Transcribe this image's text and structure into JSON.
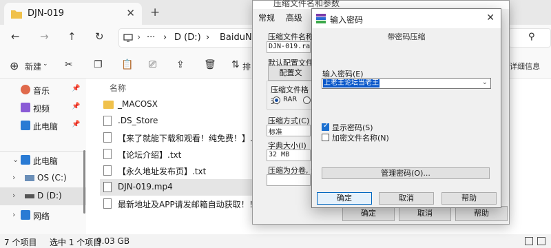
{
  "explorer": {
    "tab_title": "DJN-019",
    "breadcrumb": [
      "D (D:)",
      "BaiduNet"
    ],
    "toolbar": {
      "new_label": "新建",
      "sort_label": "排",
      "details_label": "详细信息"
    },
    "sidebar": [
      {
        "label": "音乐",
        "pinned": true
      },
      {
        "label": "视频",
        "pinned": true
      },
      {
        "label": "此电脑",
        "pinned": true
      },
      {
        "label": "此电脑",
        "pinned": false
      },
      {
        "label": "OS (C:)",
        "pinned": false
      },
      {
        "label": "D (D:)",
        "pinned": false
      },
      {
        "label": "网络",
        "pinned": false
      }
    ],
    "column_header": "名称",
    "files": [
      {
        "name": "_MACOSX",
        "type": "folder"
      },
      {
        "name": ".DS_Store",
        "type": "file"
      },
      {
        "name": "【来了就能下载和观看！纯免费！】.txt",
        "type": "file"
      },
      {
        "name": "【论坛介绍】.txt",
        "type": "file"
      },
      {
        "name": "【永久地址发布页】.txt",
        "type": "file"
      },
      {
        "name": "DJN-019.mp4",
        "type": "video"
      },
      {
        "name": "最新地址及APP请发邮箱自动获取！！！.txt",
        "type": "file"
      }
    ],
    "status": {
      "item_count": "7 个项目",
      "selected": "选中 1 个项目",
      "size": "9.03 GB"
    }
  },
  "back_dialog": {
    "title": "压缩文件名和参数",
    "tabs": [
      "常规",
      "高级"
    ],
    "archive_name_label": "压缩文件名称(A)",
    "archive_name_value": "DJN-019.rar",
    "default_profile_label": "默认配置文件",
    "profile_button": "配置文",
    "format_label": "压缩文件格式",
    "format_rar": "RAR",
    "method_label": "压缩方式(C)",
    "method_value": "标准",
    "dict_label": "字典大小(I)",
    "dict_value": "32 MB",
    "split_label": "压缩为分卷, 大",
    "ok": "确定",
    "cancel": "取消",
    "help": "帮助"
  },
  "password_dialog": {
    "title": "输入密码",
    "subtitle": "带密码压缩",
    "password_label": "输入密码(E)",
    "password_value": "上老王论坛当老王",
    "show_password_label": "显示密码(S)",
    "show_password_checked": true,
    "encrypt_names_label": "加密文件名称(N)",
    "encrypt_names_checked": false,
    "manage_button": "管理密码(O)...",
    "ok": "确定",
    "cancel": "取消",
    "help": "帮助"
  }
}
